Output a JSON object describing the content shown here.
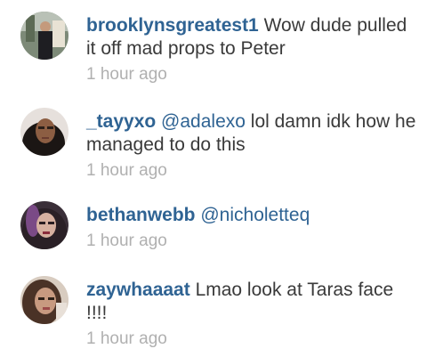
{
  "comments": [
    {
      "username": "brooklynsgreatest1",
      "mention": "",
      "text": " Wow dude pulled it off mad props to Peter",
      "time": "1 hour ago"
    },
    {
      "username": "_tayyxo",
      "mention": " @adalexo",
      "text": " lol damn idk how he managed to do this",
      "time": "1 hour ago"
    },
    {
      "username": "bethanwebb",
      "mention": " @nicholetteq",
      "text": "",
      "time": "1 hour ago"
    },
    {
      "username": "zaywhaaaat",
      "mention": "",
      "text": " Lmao look at Taras face !!!!",
      "time": "1 hour ago"
    }
  ],
  "colors": {
    "username": "#2f6393",
    "text": "#3a3a3a",
    "time": "#b0b0b0"
  },
  "icons": [
    "avatar-photo"
  ]
}
